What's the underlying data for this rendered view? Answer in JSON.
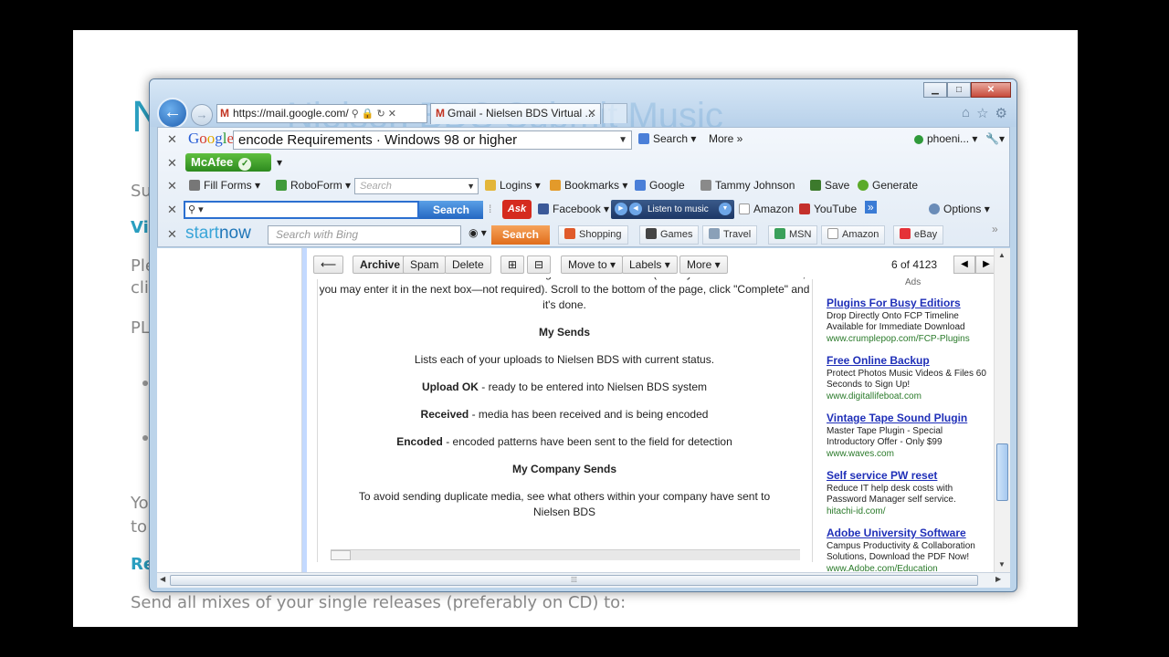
{
  "background_page": {
    "title": "N",
    "su": "Su",
    "vi": "Vi",
    "pl1": "Ple",
    "cli": "cli",
    "pl2": "PL",
    "yo": "Yo",
    "to": "to",
    "re": "Re",
    "footer": "Send all mixes of your single releases (preferably on CD) to:"
  },
  "window": {
    "ghost_text": "Nielsen BDS Submit Music",
    "address": "https://mail.google.com/",
    "tab_label": "Gmail - Nielsen BDS Virtual ..."
  },
  "google_toolbar": {
    "query": "encode Requirements · Windows 98 or higher",
    "search_label": "Search",
    "more_label": "More",
    "account": "phoeni..."
  },
  "mcafee": {
    "label": "McAfee"
  },
  "roboform": {
    "fill_forms": "Fill Forms",
    "roboform": "RoboForm",
    "search_placeholder": "Search",
    "logins": "Logins",
    "bookmarks": "Bookmarks",
    "google": "Google",
    "person": "Tammy Johnson",
    "save": "Save",
    "generate": "Generate"
  },
  "ask_toolbar": {
    "search_button": "Search",
    "ask": "Ask",
    "facebook": "Facebook",
    "listen": "Listen to music",
    "amazon": "Amazon",
    "youtube": "YouTube",
    "options": "Options"
  },
  "startnow": {
    "logo_a": "start",
    "logo_b": "now",
    "bing_placeholder": "Search with Bing",
    "search_button": "Search",
    "shopping": "Shopping",
    "games": "Games",
    "travel": "Travel",
    "msn": "MSN",
    "amazon": "Amazon",
    "ebay": "eBay"
  },
  "gmail_toolbar": {
    "archive": "Archive",
    "spam": "Spam",
    "delete": "Delete",
    "move_to": "Move to ▾",
    "labels": "Labels ▾",
    "more": "More ▾",
    "pager": "6 of 4123"
  },
  "message": {
    "para1": "DESCRIPTION\" box. Choose formats the song should be loaded to (and if you have an ISRC code, you may enter it in the next box—not required). Scroll to the bottom of the page, click \"Complete\" and it's done.",
    "my_sends_heading": "My Sends",
    "my_sends_text": "Lists each of your uploads to Nielsen BDS with current status.",
    "upload_ok_label": "Upload OK",
    "upload_ok_text": " - ready to be entered into Nielsen BDS system",
    "received_label": "Received",
    "received_text": " - media has been received and is being encoded",
    "encoded_label": "Encoded",
    "encoded_text": " - encoded patterns have been sent to the field for detection",
    "company_heading": "My Company Sends",
    "company_text": "To avoid sending duplicate media, see what others within your company have sent to Nielsen BDS"
  },
  "ads": {
    "label": "Ads",
    "items": [
      {
        "title": "Plugins For Busy Editiors",
        "body": "Drop Directly Onto FCP Timeline Available for Immediate Download",
        "url": "www.crumplepop.com/FCP-Plugins"
      },
      {
        "title": "Free Online Backup",
        "body": "Protect Photos Music Videos & Files 60 Seconds to Sign Up!",
        "url": "www.digitallifeboat.com"
      },
      {
        "title": "Vintage Tape Sound Plugin",
        "body": "Master Tape Plugin - Special Introductory Offer - Only $99",
        "url": "www.waves.com"
      },
      {
        "title": "Self service PW reset",
        "body": "Reduce IT help desk costs with Password Manager self service.",
        "url": "hitachi-id.com/"
      },
      {
        "title": "Adobe University Software",
        "body": "Campus Productivity & Collaboration Solutions, Download the PDF Now!",
        "url": "www.Adobe.com/Education"
      }
    ]
  }
}
